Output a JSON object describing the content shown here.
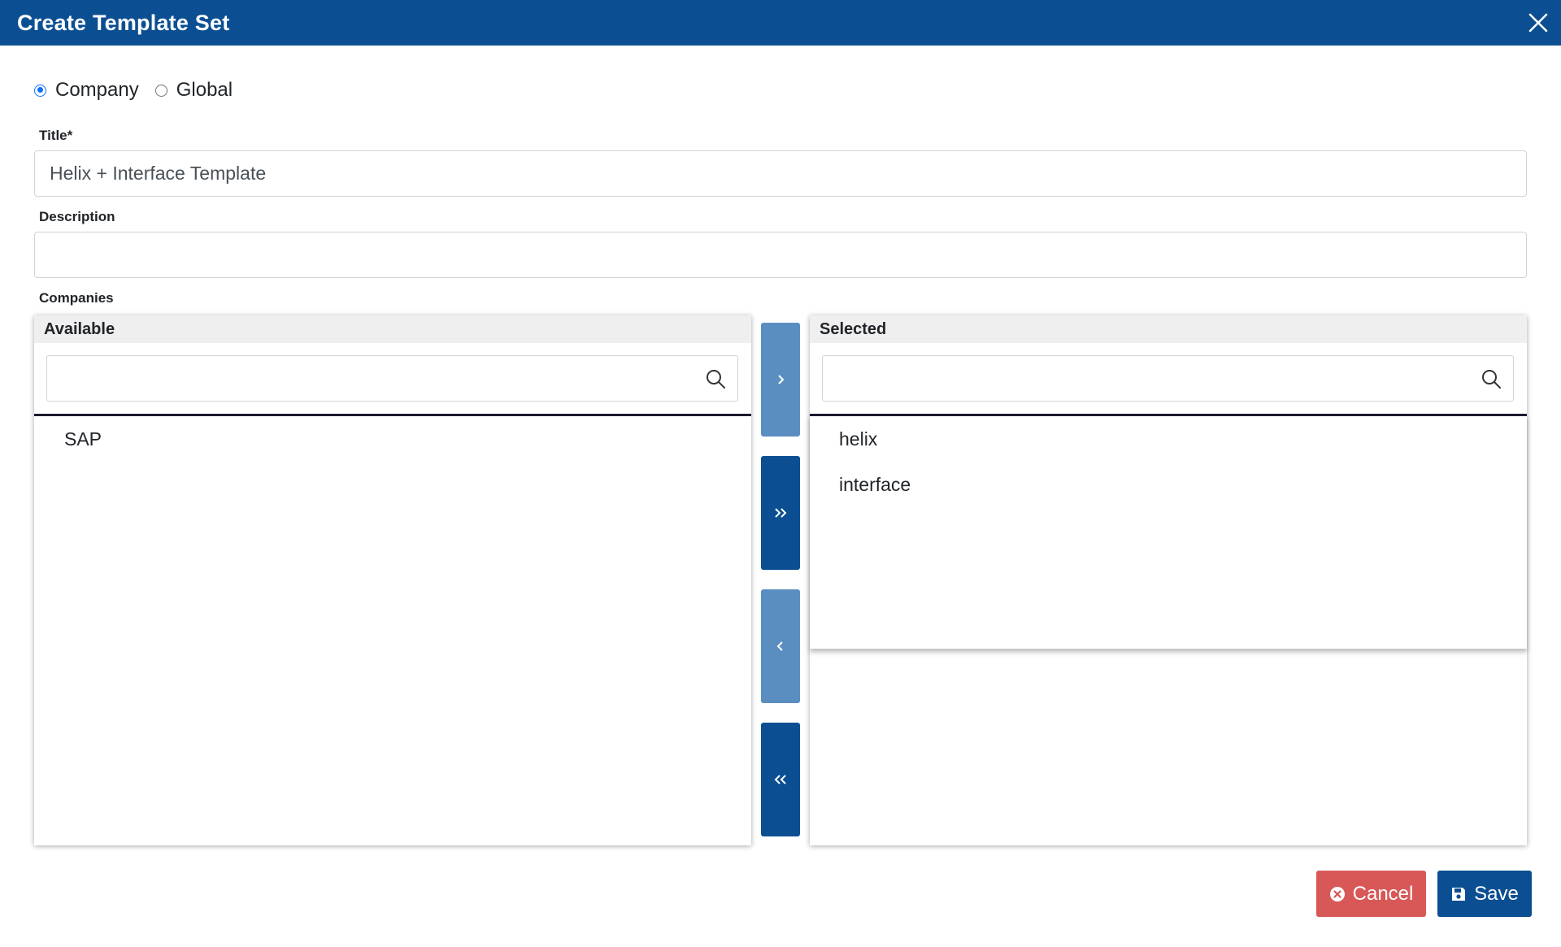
{
  "dialog": {
    "title": "Create Template Set"
  },
  "scope": {
    "options": [
      {
        "label": "Company",
        "checked": true
      },
      {
        "label": "Global",
        "checked": false
      }
    ]
  },
  "form": {
    "title_label": "Title*",
    "title_value": "Helix + Interface Template",
    "description_label": "Description",
    "description_value": "",
    "companies_label": "Companies"
  },
  "companies": {
    "available": {
      "header": "Available",
      "search_placeholder": "",
      "items": [
        "SAP"
      ]
    },
    "selected": {
      "header": "Selected",
      "search_placeholder": "",
      "items": [
        "helix",
        "interface"
      ]
    },
    "move_buttons": {
      "move_right": "chevron-right-icon",
      "move_all_right": "double-chevron-right-icon",
      "move_left": "chevron-left-icon",
      "move_all_left": "double-chevron-left-icon"
    }
  },
  "footer": {
    "cancel_label": "Cancel",
    "save_label": "Save"
  },
  "colors": {
    "header_bg": "#0b4f92",
    "move_button_light": "#5b8ec0",
    "move_button_dark": "#0b4f92",
    "cancel_bg": "#d85858",
    "save_bg": "#0b4f92",
    "radio_accent": "#0d6efd"
  }
}
